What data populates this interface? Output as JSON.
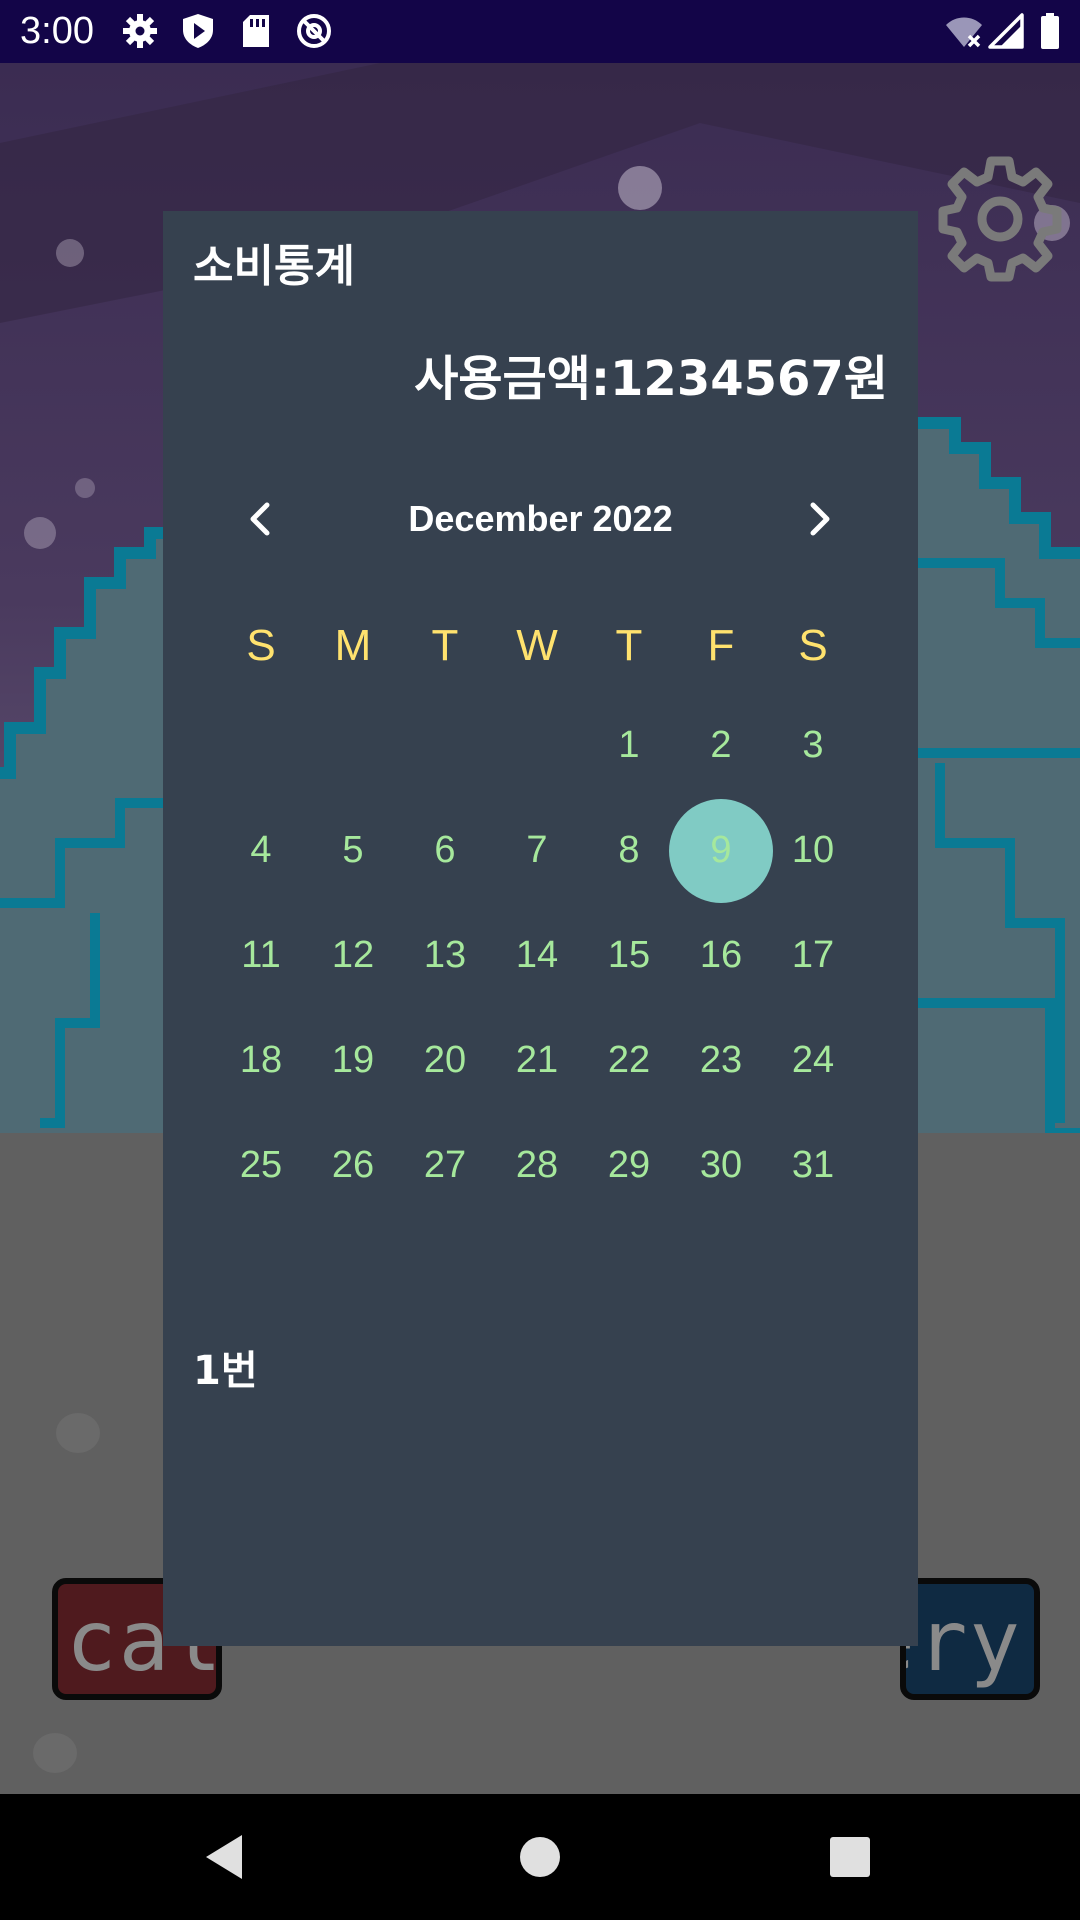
{
  "status_bar": {
    "time": "3:00",
    "icons": [
      "gear-icon",
      "shield-icon",
      "sd-card-icon",
      "blocked-at-icon",
      "wifi-off-icon",
      "signal-icon",
      "battery-icon"
    ]
  },
  "background": {
    "settings_icon": "gear-icon",
    "left_button_text": "cale",
    "right_button_text": "ery",
    "colors": {
      "sky": "#3a2b4e",
      "mountain": "#4f6a74",
      "mountain_outline": "#0a7a94",
      "ground": "#606060"
    }
  },
  "dialog": {
    "title": "소비통계",
    "amount": "사용금액:1234567원",
    "calendar": {
      "month_label": "December 2022",
      "prev_icon": "chevron-left-icon",
      "next_icon": "chevron-right-icon",
      "weekdays": [
        "S",
        "M",
        "T",
        "W",
        "T",
        "F",
        "S"
      ],
      "leading_blanks": 4,
      "days": [
        "1",
        "2",
        "3",
        "4",
        "5",
        "6",
        "7",
        "8",
        "9",
        "10",
        "11",
        "12",
        "13",
        "14",
        "15",
        "16",
        "17",
        "18",
        "19",
        "20",
        "21",
        "22",
        "23",
        "24",
        "25",
        "26",
        "27",
        "28",
        "29",
        "30",
        "31"
      ],
      "selected_day": "9",
      "colors": {
        "weekday": "#ffe26e",
        "day": "#a6e89c",
        "selected_fill": "#80cbc4"
      }
    },
    "footer_label": "1번",
    "colors": {
      "background": "#36414f"
    }
  },
  "nav_bar": {
    "icons": [
      "back-triangle-icon",
      "home-circle-icon",
      "recents-square-icon"
    ]
  }
}
